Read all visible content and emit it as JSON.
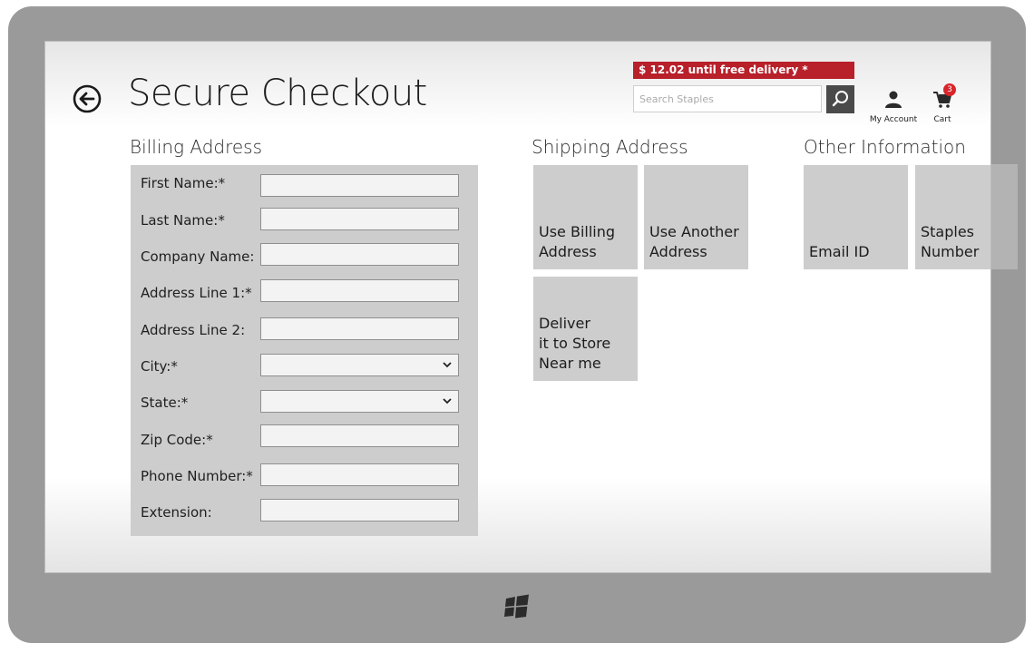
{
  "page": {
    "title": "Secure Checkout"
  },
  "header": {
    "promo_text": "$ 12.02 until free delivery *",
    "search_placeholder": "Search Staples",
    "account_label": "My Account",
    "cart_label": "Cart",
    "cart_count": "3"
  },
  "billing": {
    "heading": "Billing Address",
    "fields": [
      {
        "label": "First Name:*",
        "type": "text",
        "value": ""
      },
      {
        "label": "Last Name:*",
        "type": "text",
        "value": ""
      },
      {
        "label": "Company Name:",
        "type": "text",
        "value": ""
      },
      {
        "label": "Address Line 1:*",
        "type": "text",
        "value": ""
      },
      {
        "label": "Address Line 2:",
        "type": "text",
        "value": ""
      },
      {
        "label": "City:*",
        "type": "select",
        "value": ""
      },
      {
        "label": "State:*",
        "type": "select",
        "value": ""
      },
      {
        "label": "Zip Code:*",
        "type": "text",
        "value": ""
      },
      {
        "label": "Phone Number:*",
        "type": "text",
        "value": ""
      },
      {
        "label": "Extension:",
        "type": "text",
        "value": ""
      }
    ]
  },
  "shipping": {
    "heading": "Shipping Address",
    "tiles": [
      {
        "label": "Use Billing\nAddress"
      },
      {
        "label": "Use Another\nAddress"
      },
      {
        "label": "Deliver\nit to Store\nNear me"
      }
    ]
  },
  "other": {
    "heading": "Other Information",
    "tiles": [
      {
        "label": "Email ID"
      },
      {
        "label": "Staples\nNumber"
      }
    ]
  },
  "colors": {
    "promo_bg": "#b8202a",
    "tile_bg": "#cdcdcd",
    "badge_bg": "#d9262c",
    "device_frame": "#9a9a9a"
  },
  "icons": {
    "back": "back-arrow-icon",
    "search": "search-icon",
    "account": "user-icon",
    "cart": "cart-icon",
    "windows": "windows-logo-icon",
    "dropdown": "chevron-down-icon"
  }
}
